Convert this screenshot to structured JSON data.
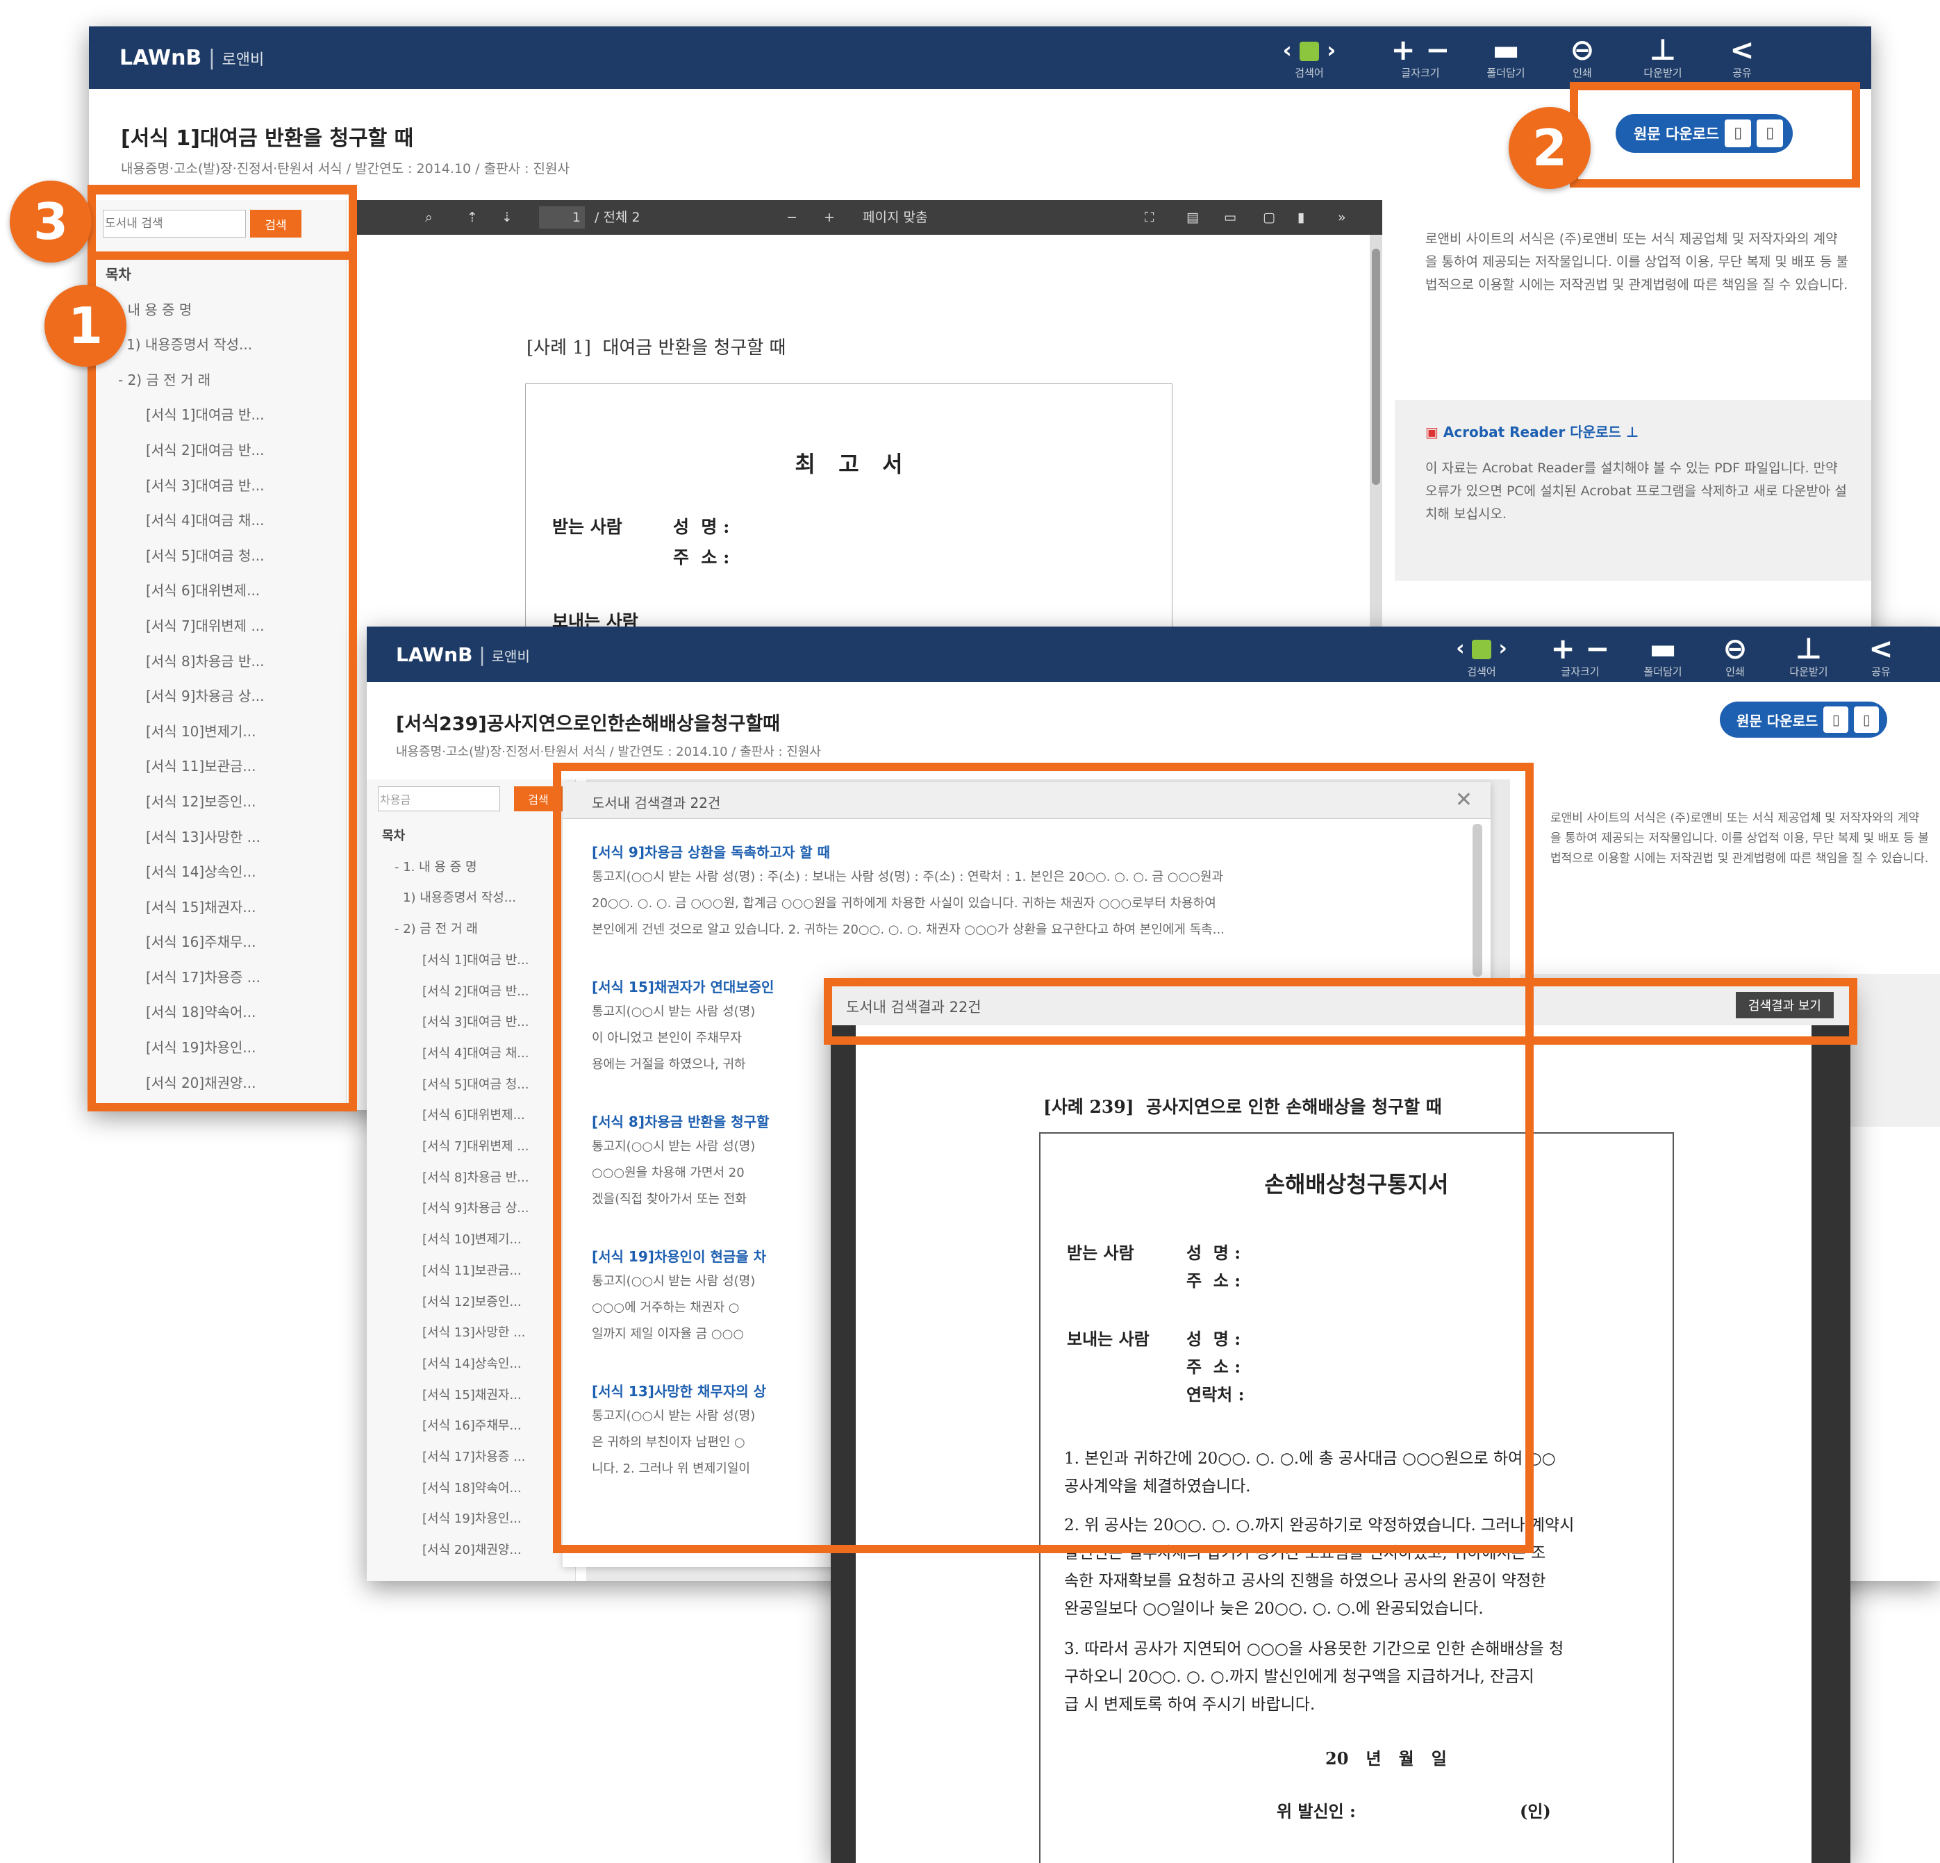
{
  "app": {
    "brand": "LAWnB",
    "brand_sub": "로앤비",
    "tools": [
      {
        "icon": "bookmark-icon",
        "label": "검색어"
      },
      {
        "icon": "zoom-icon",
        "label": "글자크기"
      },
      {
        "icon": "folder-icon",
        "label": "폴더담기"
      },
      {
        "icon": "print-icon",
        "label": "인쇄"
      },
      {
        "icon": "download-icon",
        "label": "다운받기"
      },
      {
        "icon": "share-icon",
        "label": "공유"
      }
    ],
    "tool_glyphs": {
      "nav": "‹ ›",
      "zoom": "+ −",
      "folder": "▬",
      "print": "⊖",
      "download": "⊥",
      "share": "<"
    },
    "download_button": "원문 다운로드"
  },
  "screen1": {
    "title": "[서식 1]대여금 반환을 청구할 때",
    "meta": "내용증명·고소(발)장·진정서·탄원서 서식 / 발간연도 : 2014.10 / 출판사 : 진원사",
    "search_placeholder": "도서내 검색",
    "search_button": "검색",
    "toc_header": "목차",
    "toc": [
      "- 내 용 증 명",
      "1) 내용증명서 작성...",
      "- 2) 금 전 거 래",
      "[서식 1]대여금 반...",
      "[서식 2]대여금 반...",
      "[서식 3]대여금 반...",
      "[서식 4]대여금 채...",
      "[서식 5]대여금 청...",
      "[서식 6]대위변제...",
      "[서식 7]대위변제 ...",
      "[서식 8]차용금 반...",
      "[서식 9]차용금 상...",
      "[서식 10]변제기...",
      "[서식 11]보관금...",
      "[서식 12]보증인...",
      "[서식 13]사망한 ...",
      "[서식 14]상속인...",
      "[서식 15]채권자...",
      "[서식 16]주채무...",
      "[서식 17]차용증 ...",
      "[서식 18]약속어...",
      "[서식 19]차용인...",
      "[서식 20]채권양..."
    ],
    "viewer_toolbar": {
      "page": "1",
      "total": "/ 전체 2",
      "zoom": "페이지 맞춤"
    },
    "page_heading": "[사례 1]  대여금 반환을 청구할 때",
    "form_title": "최   고   서",
    "recipient_label": "받는 사람",
    "name_label": "성  명 :",
    "address_label": "주  소 :",
    "sender_label": "보내는 사람",
    "info_text": "로앤비 사이트의 서식은 (주)로앤비 또는 서식 제공업체 및 저작자와의 계약을 통하여 제공되는 저작물입니다. 이를 상업적 이용, 무단 복제 및 배포 등 불법적으로 이용할 시에는 저작권법 및 관계법령에 따른 책임을 질 수 있습니다.",
    "acrobat_link": "Acrobat Reader 다운로드",
    "acrobat_text": "이 자료는 Acrobat Reader를 설치해야 볼 수 있는 PDF 파일입니다. 만약 오류가 있으면 PC에 설치된 Acrobat 프로그램을 삭제하고 새로 다운받아 설치해 보십시오."
  },
  "screen2": {
    "title": "[서식239]공사지연으로인한손해배상을청구할때",
    "meta": "내용증명·고소(발)장·진정서·탄원서 서식 / 발간연도 : 2014.10 / 출판사 : 진원사",
    "search_value": "차용금",
    "search_button": "검색",
    "toc_header": "목차",
    "toc": [
      "- 1. 내 용 증 명",
      "1) 내용증명서 작성...",
      "- 2) 금 전 거 래",
      "[서식 1]대여금 반...",
      "[서식 2]대여금 반...",
      "[서식 3]대여금 반...",
      "[서식 4]대여금 채...",
      "[서식 5]대여금 청...",
      "[서식 6]대위변제...",
      "[서식 7]대위변제 ...",
      "[서식 8]차용금 반...",
      "[서식 9]차용금 상...",
      "[서식 10]변제기...",
      "[서식 11]보관금...",
      "[서식 12]보증인...",
      "[서식 13]사망한 ...",
      "[서식 14]상속인...",
      "[서식 15]채권자...",
      "[서식 16]주채무...",
      "[서식 17]차용증 ...",
      "[서식 18]약속어...",
      "[서식 19]차용인...",
      "[서식 20]채권양..."
    ],
    "results_header": "도서내 검색결과 22건",
    "results": [
      {
        "title": "[서식 9]차용금 상환을 독촉하고자 할 때",
        "lines": [
          "통고지(○○시 받는 사람 성(명) : 주(소) : 보내는 사람 성(명) : 주(소) : 연락처 : 1. 본인은 20○○. ○. ○. 금 ○○○원과",
          "20○○. ○. ○. 금 ○○○원, 합계금 ○○○원을 귀하에게 차용한 사실이 있습니다. 귀하는 채권자 ○○○로부터 차용하여",
          "본인에게 건넨 것으로 알고 있습니다. 2. 귀하는 20○○. ○. ○. 채권자 ○○○가 상환을 요구한다고 하여 본인에게 독촉..."
        ]
      },
      {
        "title": "[서식 15]채권자가 연대보증인",
        "lines": [
          "통고지(○○시 받는 사람 성(명)",
          "이 아니었고 본인이 주채무자",
          "용에는 거절을 하였으나, 귀하"
        ]
      },
      {
        "title": "[서식 8]차용금 반환을 청구할",
        "lines": [
          "통고지(○○시 받는 사람 성(명)",
          "○○○원을 차용해 가면서 20",
          "겠을(직접 찾아가서 또는 전화"
        ]
      },
      {
        "title": "[서식 19]차용인이 현금을 차",
        "lines": [
          "통고지(○○시 받는 사람 성(명)",
          "○○○에 거주하는 채권자 ○",
          "일까지 제일 이자율 금 ○○○"
        ]
      },
      {
        "title": "[서식 13]사망한 채무자의 상",
        "lines": [
          "통고지(○○시 받는 사람 성(명)",
          "은 귀하의 부친이자 남편인 ○",
          "니다. 2. 그러나 위 변제기일이"
        ]
      }
    ],
    "info_text": "로앤비 사이트의 서식은 (주)로앤비 또는 서식 제공업체 및 저작자와의 계약을 통하여 제공되는 저작물입니다. 이를 상업적 이용, 무단 복제 및 배포 등 불법적으로 이용할 시에는 저작권법 및 관계법령에 따른 책임을 질 수 있습니다."
  },
  "screen3": {
    "header": "도서내 검색결과 22건",
    "button": "검색결과 보기",
    "page_heading": "[사례 239]  공사지연으로 인한 손해배상을 청구할 때",
    "form_title": "손해배상청구통지서",
    "recipient_label": "받는 사람",
    "sender_label": "보내는 사람",
    "name_label": "성  명 :",
    "address_label": "주  소 :",
    "phone_label": "연락처 :",
    "para1": [
      "1. 본인과 귀하간에 20○○. ○. ○.에 총 공사대금 ○○○원으로 하여 ○○",
      "공사계약을 체결하였습니다."
    ],
    "para2": [
      "2. 위 공사는 20○○. ○. ○.까지 완공하기로 약정하였습니다. 그러나 계약시",
      "발신인은 일부자재의 납기가 장기간 소요됨을 인지하였고, 귀하에서는 조",
      "속한 자재확보를 요청하고 공사의 진행을 하였으나 공사의 완공이 약정한",
      "완공일보다 ○○일이나 늦은 20○○. ○. ○.에 완공되었습니다."
    ],
    "para3": [
      "3. 따라서 공사가 지연되어 ○○○을 사용못한 기간으로 인한 손해배상을 청",
      "구하오니 20○○. ○. ○.까지 발신인에게 청구액을 지급하거나, 잔금지",
      "급 시 변제토록 하여 주시기 바랍니다."
    ],
    "date_line": "20   년   월   일",
    "signer": "위 발신인 :",
    "seal": "(인)"
  },
  "callouts": [
    "1",
    "2",
    "3"
  ],
  "colors": {
    "navy": "#1d3b66",
    "orange": "#ef6c1d",
    "blue": "#1d5fb0",
    "highlight": "#ffe94d"
  }
}
